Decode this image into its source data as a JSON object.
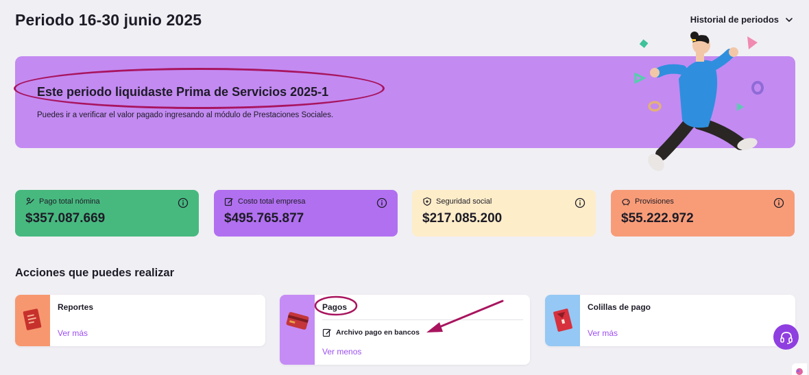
{
  "header": {
    "title": "Periodo 16-30 junio 2025",
    "period_history_label": "Historial de periodos"
  },
  "banner": {
    "title": "Este periodo liquidaste Prima de Servicios 2025-1",
    "text": "Puedes ir a verificar el valor pagado ingresando al módulo de Prestaciones Sociales."
  },
  "stats": [
    {
      "label": "Pago total nómina",
      "value": "$357.087.669",
      "color": "#47b97f",
      "icon": "payroll-icon"
    },
    {
      "label": "Costo total empresa",
      "value": "$495.765.877",
      "color": "#b170f0",
      "icon": "edit-icon"
    },
    {
      "label": "Seguridad social",
      "value": "$217.085.200",
      "color": "#fdedc9",
      "icon": "shield-plus-icon"
    },
    {
      "label": "Provisiones",
      "value": "$55.222.972",
      "color": "#f89c78",
      "icon": "piggy-bank-icon"
    }
  ],
  "actions": {
    "section_title": "Acciones que puedes realizar",
    "reportes": {
      "title": "Reportes",
      "link": "Ver más",
      "thumb_color": "#f7976f"
    },
    "pagos": {
      "title": "Pagos",
      "sub_item": "Archivo pago en bancos",
      "link": "Ver menos",
      "thumb_color": "#c58cf5"
    },
    "colillas": {
      "title": "Colillas de pago",
      "link": "Ver más",
      "thumb_color": "#95c8f4"
    }
  },
  "colors": {
    "banner": "#c38af2",
    "accent": "#9c4ef0",
    "annotation": "#a8145e",
    "support_button": "#8f3fe0"
  }
}
